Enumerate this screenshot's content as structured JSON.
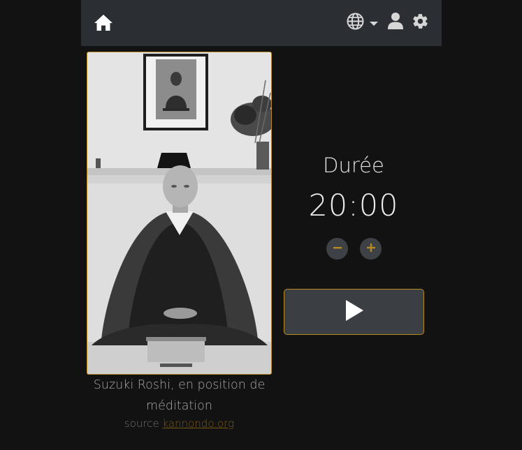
{
  "navbar": {
    "home_icon": "home-icon",
    "language_icon": "globe-icon",
    "user_icon": "user-icon",
    "settings_icon": "gear-icon"
  },
  "photo": {
    "caption": "Suzuki Roshi, en position de méditation",
    "source_prefix": "source",
    "source_link": "kannondo.org"
  },
  "timer": {
    "label": "Durée",
    "value": "20:00",
    "minus_icon": "minus-icon",
    "plus_icon": "plus-icon"
  },
  "play_icon": "play-icon",
  "colors": {
    "accent": "#b58a22",
    "navbar_bg": "#2b2f33",
    "page_bg": "#121212",
    "button_bg": "#3b3f44"
  }
}
